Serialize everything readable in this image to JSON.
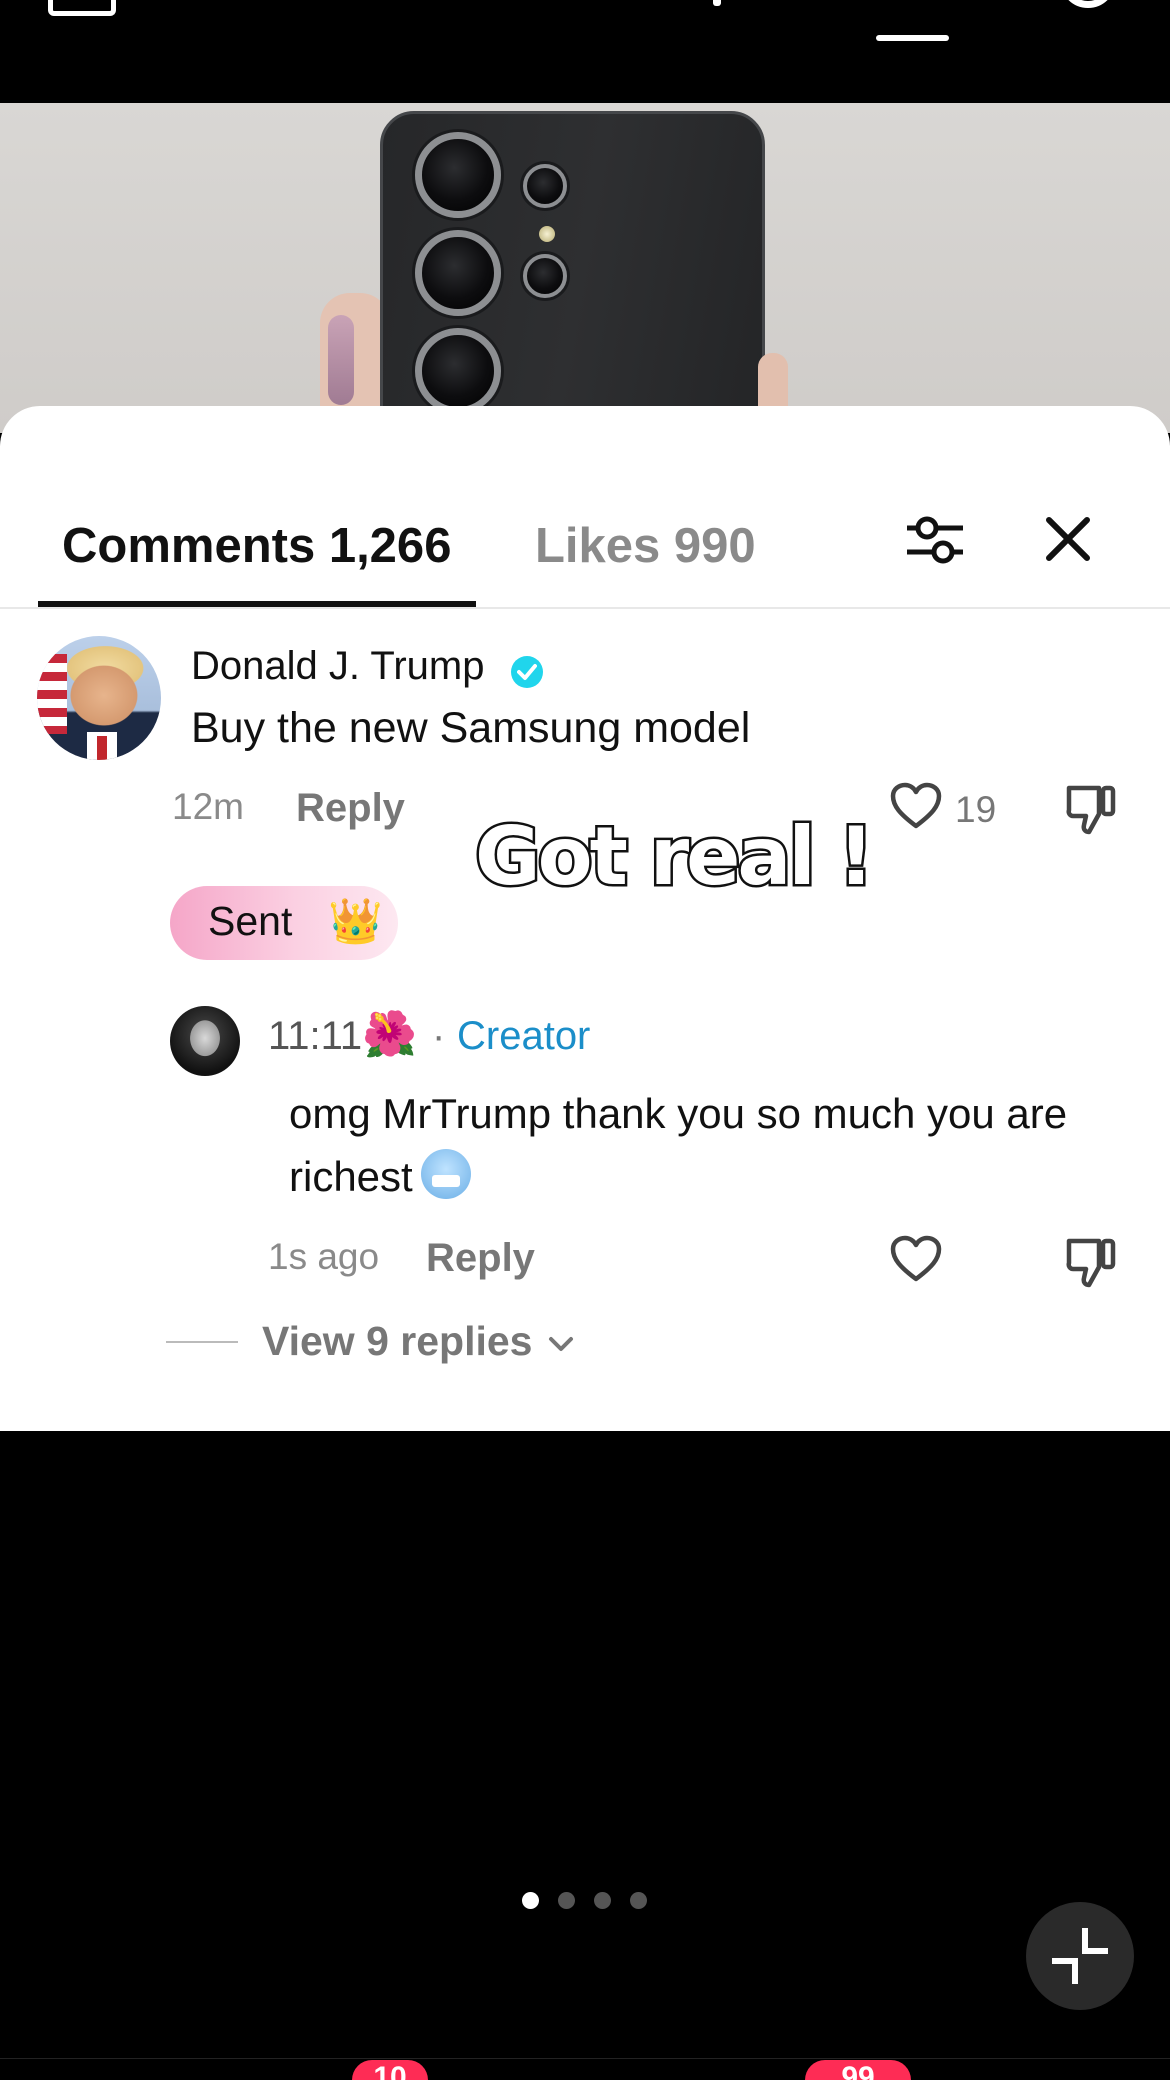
{
  "overlay_caption": "Got real !",
  "tabs": {
    "comments": "Comments 1,266",
    "likes": "Likes 990"
  },
  "comment": {
    "author": "Donald J. Trump",
    "text": "Buy the new Samsung model",
    "time": "12m",
    "reply_label": "Reply",
    "like_count": "19",
    "gift_label": "Sent",
    "gift_emoji": "👑"
  },
  "reply": {
    "author": "11:11",
    "author_emoji": "🌺",
    "separator": "·",
    "badge": "Creator",
    "text": "omg MrTrump thank you so much you are richest",
    "time": "1s ago",
    "reply_label": "Reply"
  },
  "view_replies": "View 9 replies",
  "pager": {
    "pages": 4,
    "active": 1
  },
  "nav_badges": {
    "left": "10",
    "right": "99"
  },
  "colors": {
    "accent_creator": "#1b8ec9",
    "verified": "#20d5ec",
    "badge": "#fe2c55"
  }
}
